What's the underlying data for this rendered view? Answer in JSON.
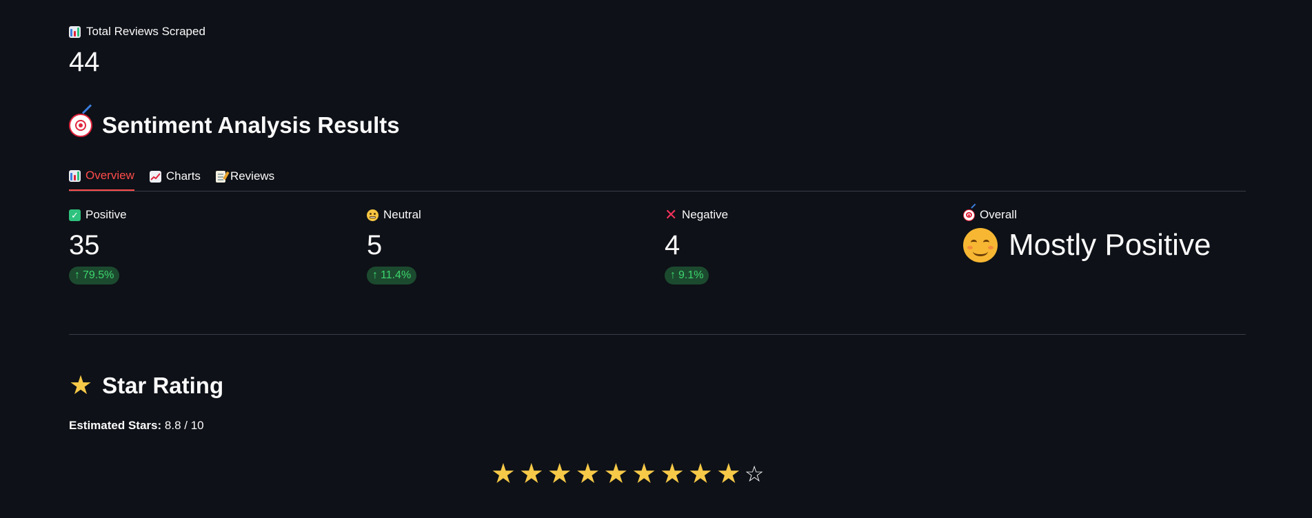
{
  "total": {
    "label": "Total Reviews Scraped",
    "value": "44"
  },
  "sentiment_section": {
    "title": "Sentiment Analysis Results"
  },
  "tabs": [
    {
      "label": "Overview",
      "icon": "bar-chart-icon",
      "active": true
    },
    {
      "label": "Charts",
      "icon": "line-chart-icon",
      "active": false
    },
    {
      "label": "Reviews",
      "icon": "memo-icon",
      "active": false
    }
  ],
  "metrics": {
    "positive": {
      "label": "Positive",
      "value": "35",
      "delta": "79.5%"
    },
    "neutral": {
      "label": "Neutral",
      "value": "5",
      "delta": "11.4%"
    },
    "negative": {
      "label": "Negative",
      "value": "4",
      "delta": "9.1%"
    },
    "overall": {
      "label": "Overall",
      "value": "Mostly Positive"
    }
  },
  "star_section": {
    "title": "Star Rating",
    "estimate_label": "Estimated Stars:",
    "estimate_value": "8.8 / 10",
    "filled_stars": 9,
    "empty_stars": 1
  },
  "colors": {
    "background": "#0e1117",
    "accent": "#ff4b4b",
    "delta_bg": "#1c4a2f",
    "delta_text": "#3dd56d",
    "star": "#f7c948"
  }
}
